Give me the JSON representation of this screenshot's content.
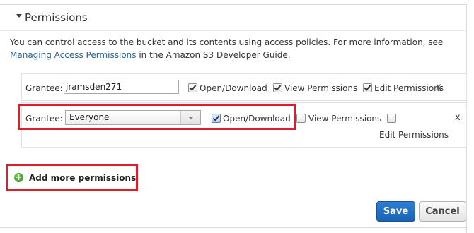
{
  "section": {
    "title": "Permissions",
    "description": "You can control access to the bucket and its contents using access policies. For more information, see",
    "link_text": "Managing Access Permissions",
    "description_suffix": " in the Amazon S3 Developer Guide."
  },
  "grants": [
    {
      "grantee_label": "Grantee:",
      "grantee_value": "jramsden271",
      "open_download": {
        "label": "Open/Download",
        "checked": true
      },
      "view_permissions": {
        "label": "View Permissions",
        "checked": true
      },
      "edit_permissions": {
        "label": "Edit Permissions",
        "checked": true
      },
      "remove": "x"
    },
    {
      "grantee_label": "Grantee:",
      "grantee_value": "Everyone",
      "open_download": {
        "label": "Open/Download",
        "checked": true
      },
      "view_permissions": {
        "label": "View Permissions",
        "checked": false
      },
      "edit_permissions": {
        "label": "Edit Permissions",
        "checked": false
      },
      "remove": "x"
    }
  ],
  "add_more": "Add more permissions",
  "buttons": {
    "save": "Save",
    "cancel": "Cancel"
  },
  "colors": {
    "highlight": "#e21b2a",
    "primary": "#1a63b4",
    "link": "#2a6496"
  }
}
